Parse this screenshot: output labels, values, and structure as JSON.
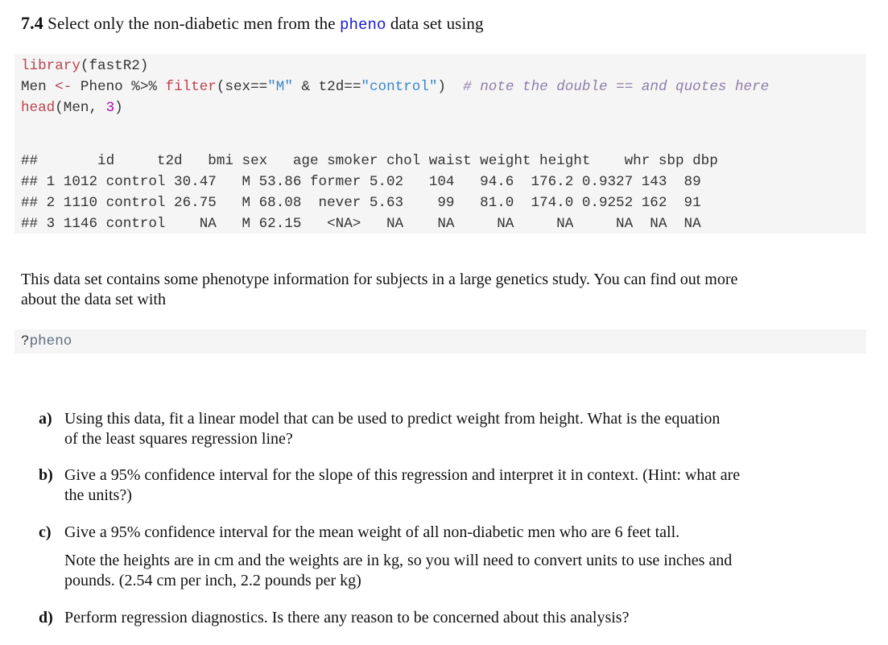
{
  "heading": {
    "number": "7.4",
    "text_before": " Select only the non-diabetic men from the ",
    "keyword": "pheno",
    "text_after": " data set using"
  },
  "code_main": {
    "line1": {
      "fn": "library",
      "rest": "(fastR2)"
    },
    "line2": {
      "a": "Men ",
      "assign": "<-",
      "b": " Pheno ",
      "pipe": "%>%",
      "c": " ",
      "fn": "filter",
      "d": "(sex==",
      "s1": "\"M\"",
      "e": " & t2d==",
      "s2": "\"control\"",
      "f": ")  ",
      "comment": "# note the double == and quotes here"
    },
    "line3": {
      "fn": "head",
      "a": "(Men, ",
      "num": "3",
      "b": ")"
    },
    "output": {
      "header": "##       id     t2d   bmi sex   age smoker chol waist weight height    whr sbp dbp",
      "rows": [
        "## 1 1012 control 30.47   M 53.86 former 5.02   104   94.6  176.2 0.9327 143  89",
        "## 2 1110 control 26.75   M 68.08  never 5.63    99   81.0  174.0 0.9252 162  91",
        "## 3 1146 control    NA   M 62.15   <NA>   NA    NA     NA     NA     NA  NA  NA"
      ]
    }
  },
  "paragraph": {
    "line1": "This data set contains some phenotype information for subjects in a large genetics study. You can find out more",
    "line2": "about the data set with"
  },
  "code_help": {
    "q": "?",
    "name": "pheno"
  },
  "questions": [
    {
      "label": "a)",
      "lines": [
        "Using this data, fit a linear model that can be used to predict weight from height. What is the equation",
        "of the least squares regression line?"
      ]
    },
    {
      "label": "b)",
      "lines": [
        "Give a 95% confidence interval for the slope of this regression and interpret it in context. (Hint: what are",
        "the units?)"
      ]
    },
    {
      "label": "c)",
      "lines": [
        "Give a 95% confidence interval for the mean weight of all non-diabetic men who are 6 feet tall."
      ],
      "note_lines": [
        "Note the heights are in cm and the weights are in kg, so you will need to convert units to use inches and",
        "pounds. (2.54 cm per inch, 2.2 pounds per kg)"
      ]
    },
    {
      "label": "d)",
      "lines": [
        "Perform regression diagnostics. Is there any reason to be concerned about this analysis?"
      ]
    }
  ]
}
